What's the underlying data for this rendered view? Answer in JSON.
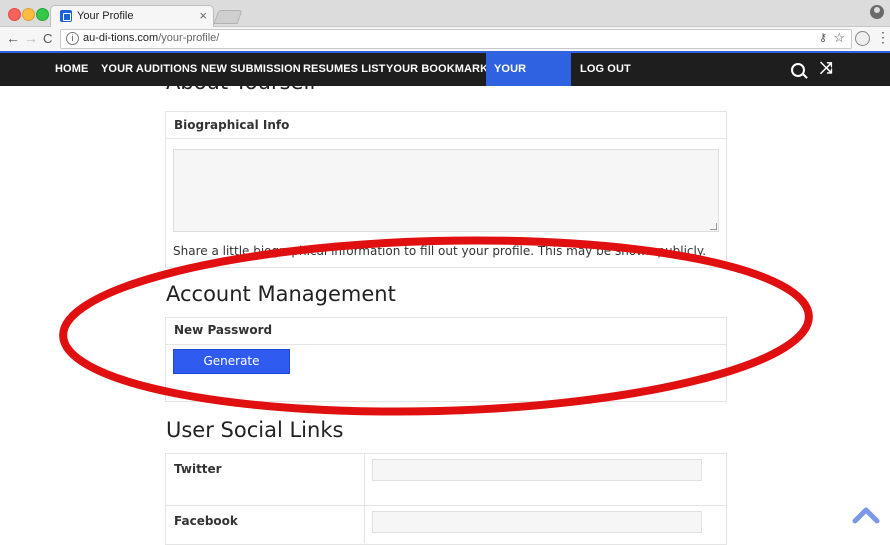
{
  "browser": {
    "tab_title": "Your Profile",
    "tab_close": "×",
    "url_domain": "au-di-tions.com",
    "url_path": "/your-profile/",
    "back": "←",
    "forward": "→",
    "reload": "C"
  },
  "nav": {
    "items": [
      {
        "label": "HOME"
      },
      {
        "label": "YOUR AUDITIONS"
      },
      {
        "label": "NEW SUBMISSION"
      },
      {
        "label": "RESUMES LIST"
      },
      {
        "label": "YOUR BOOKMARKS"
      },
      {
        "label": "YOUR PROFILE"
      },
      {
        "label": "LOG OUT"
      }
    ],
    "active_index": 5,
    "bg_color": "#1e1e1e",
    "active_color": "#2f62e0"
  },
  "about": {
    "heading": "About Yourself",
    "bio_label": "Biographical Info",
    "bio_value": "",
    "hint": "Share a little biographical information to fill out your profile. This may be shown publicly."
  },
  "account": {
    "heading": "Account Management",
    "password_label": "New Password",
    "generate_button": "Generate Password"
  },
  "social": {
    "heading": "User Social Links",
    "rows": [
      {
        "label": "Twitter",
        "value": ""
      },
      {
        "label": "Facebook",
        "value": ""
      }
    ]
  },
  "annotation": {
    "color": "#e01010"
  },
  "icons": [
    "search-icon",
    "shuffle-icon",
    "scroll-top-icon",
    "info-icon",
    "star-icon",
    "key-icon"
  ]
}
